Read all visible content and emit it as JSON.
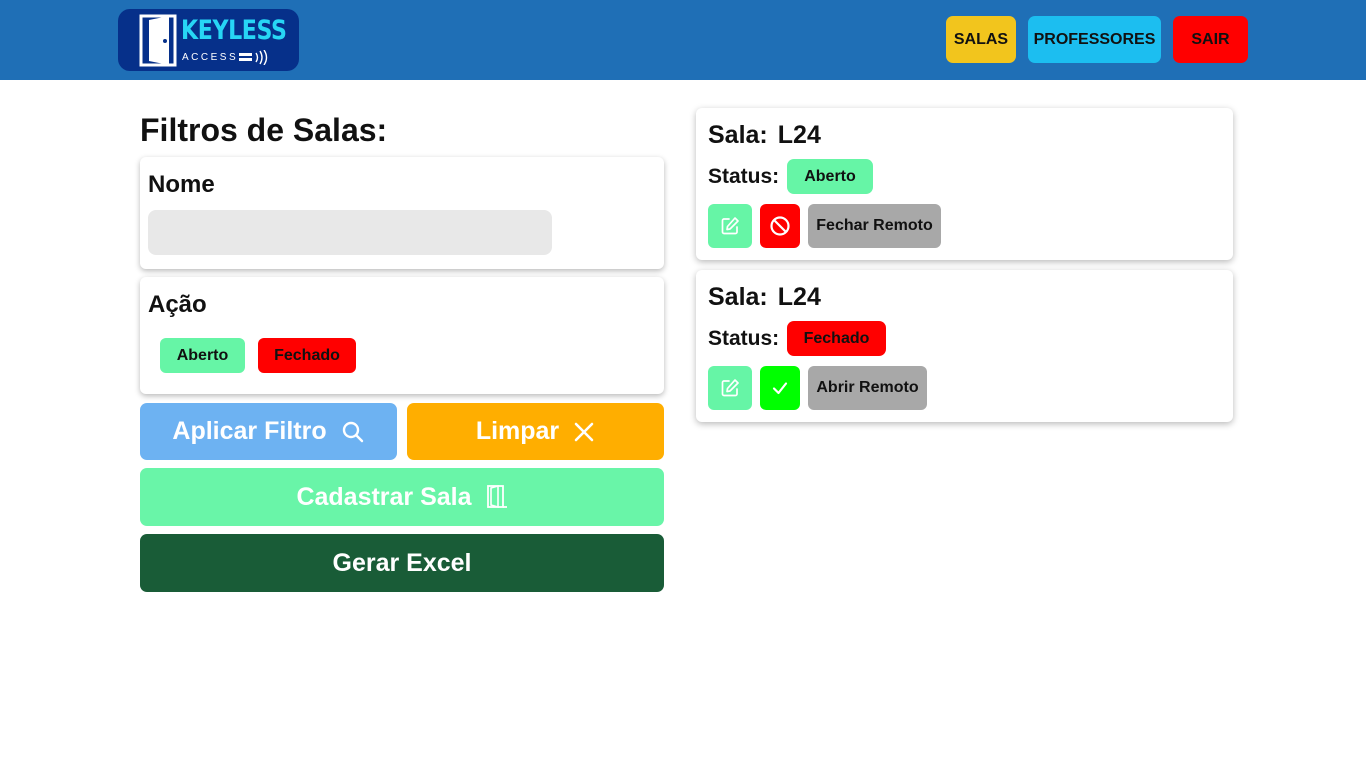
{
  "header": {
    "logo_title": "KEYLESS",
    "logo_subtitle": "ACCESS",
    "nav": {
      "salas": "SALAS",
      "professores": "PROFESSORES",
      "sair": "SAIR"
    }
  },
  "filters": {
    "title": "Filtros de Salas:",
    "nome_label": "Nome",
    "nome_value": "",
    "acao_label": "Ação",
    "acao_options": [
      "Aberto",
      "Fechado"
    ]
  },
  "actions": {
    "aplicar": "Aplicar Filtro",
    "limpar": "Limpar",
    "cadastrar": "Cadastrar Sala",
    "excel": "Gerar Excel"
  },
  "rooms": [
    {
      "sala_label": "Sala:",
      "sala_name": "L24",
      "status_label": "Status:",
      "status": "Aberto",
      "remote_action": "Fechar Remoto"
    },
    {
      "sala_label": "Sala:",
      "sala_name": "L24",
      "status_label": "Status:",
      "status": "Fechado",
      "remote_action": "Abrir Remoto"
    }
  ],
  "colors": {
    "header_bg": "#1f6fb6",
    "salas": "#f2c51d",
    "professores": "#1cbef0",
    "sair": "#ff0000",
    "open_green": "#66f5a6",
    "closed_red": "#ff0000",
    "aplicar": "#6db2f2",
    "limpar": "#ffae00",
    "excel": "#195c37"
  }
}
